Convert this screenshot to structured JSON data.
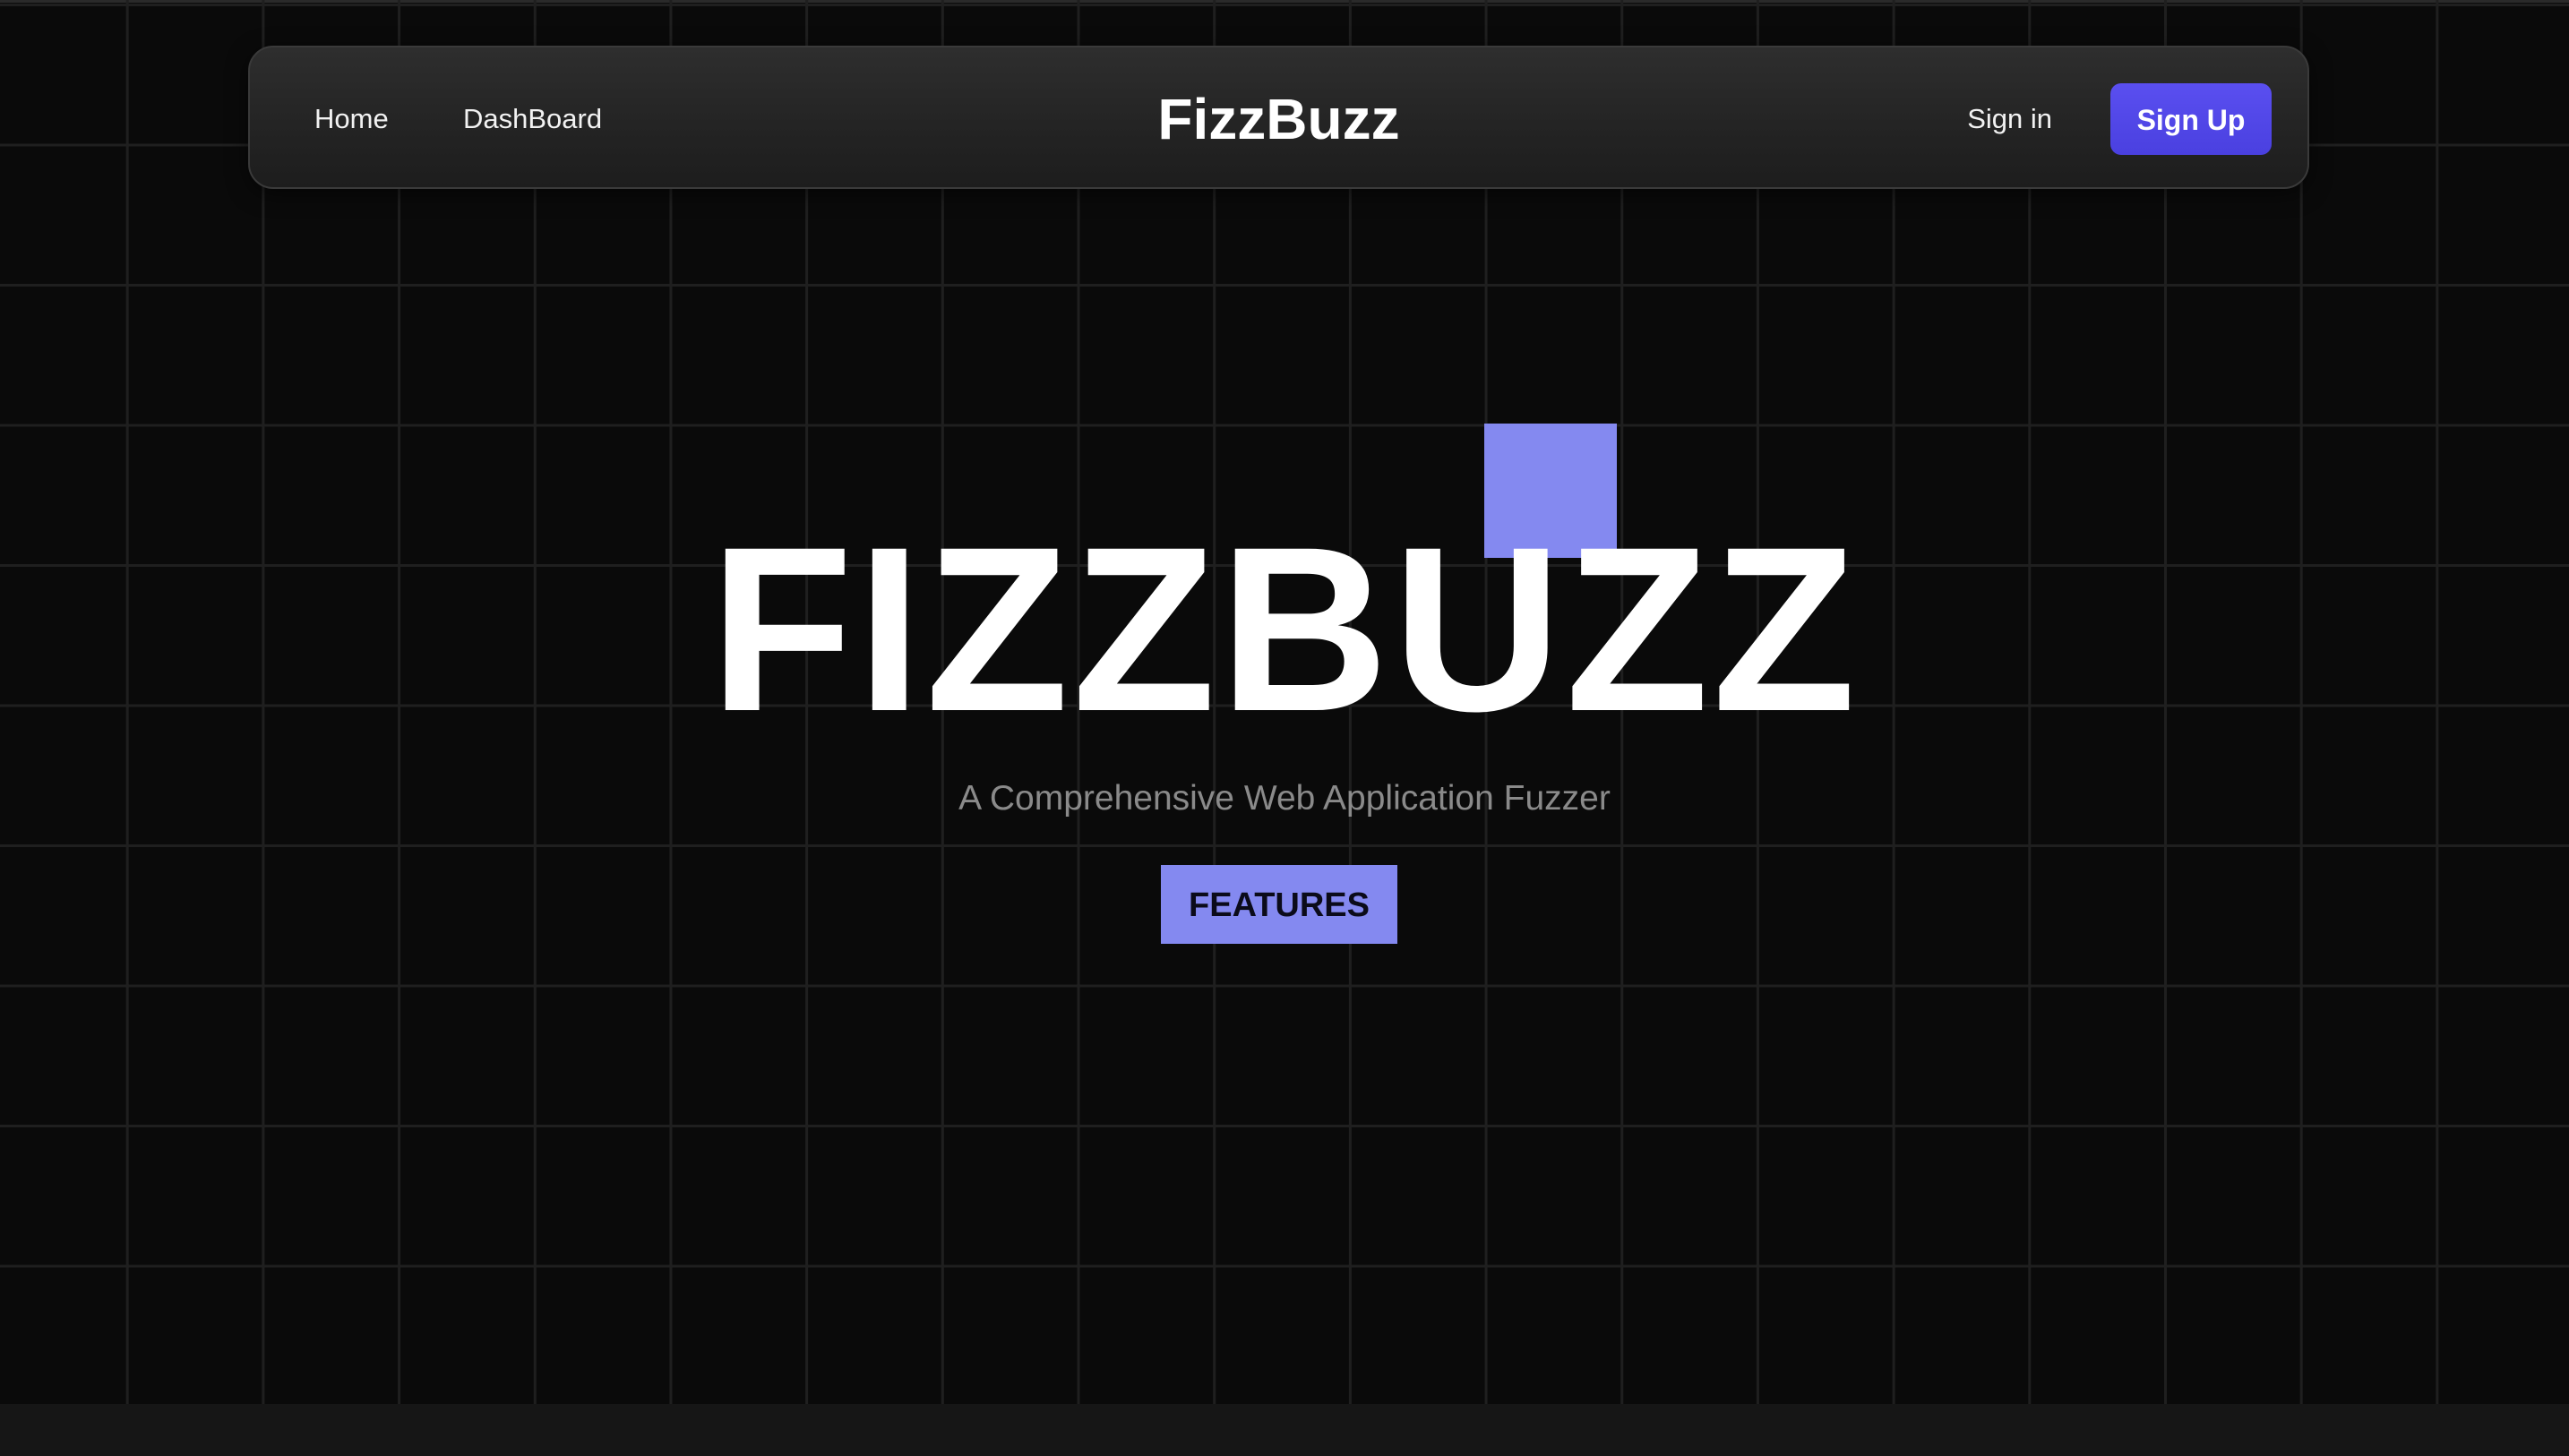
{
  "navbar": {
    "home_label": "Home",
    "dashboard_label": "DashBoard",
    "logo_text": "FizzBuzz",
    "signin_label": "Sign in",
    "signup_label": "Sign Up"
  },
  "hero": {
    "title": "FIZZBUZZ",
    "subtitle": "A Comprehensive Web Application Fuzzer",
    "features_label": "FEATURES"
  },
  "colors": {
    "background": "#0a0a0a",
    "accent": "#8489f0",
    "primary_button": "#5046e5",
    "grid_line": "#1f1f1f"
  }
}
